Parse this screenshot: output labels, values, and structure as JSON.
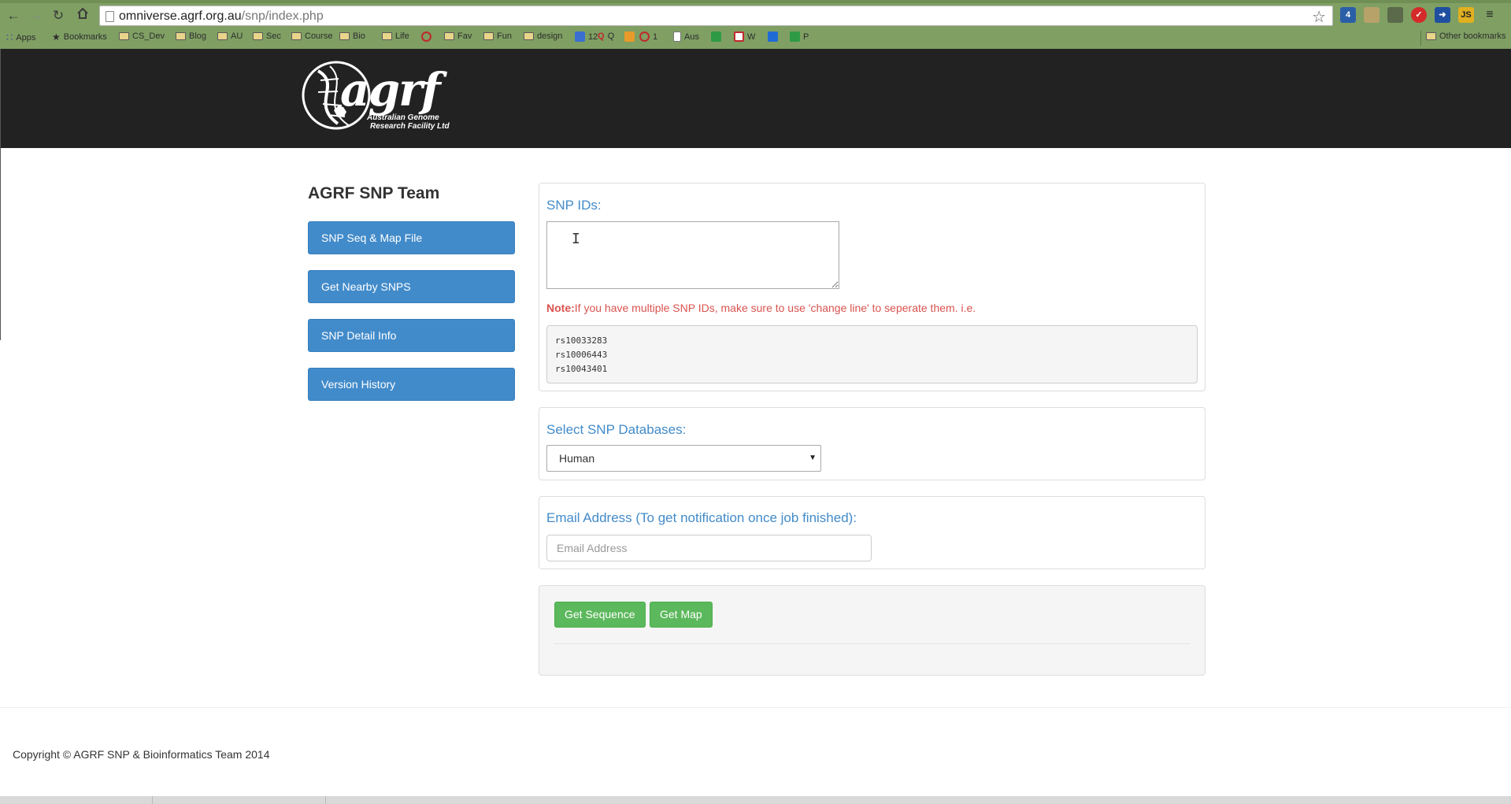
{
  "browser": {
    "url_domain": "omniverse.agrf.org.au",
    "url_path": "/snp/index.php",
    "bookmarks": [
      {
        "label": "Apps",
        "kind": "apps"
      },
      {
        "label": "Bookmarks",
        "kind": "star"
      },
      {
        "label": "CS_Dev",
        "kind": "folder"
      },
      {
        "label": "Blog",
        "kind": "folder"
      },
      {
        "label": "AU",
        "kind": "folder"
      },
      {
        "label": "Sec",
        "kind": "folder"
      },
      {
        "label": "Course",
        "kind": "folder"
      },
      {
        "label": "Bio",
        "kind": "folder"
      },
      {
        "label": "Life",
        "kind": "folder"
      },
      {
        "label": "",
        "kind": "target"
      },
      {
        "label": "Fav",
        "kind": "folder"
      },
      {
        "label": "Fun",
        "kind": "folder"
      },
      {
        "label": "design",
        "kind": "folder"
      },
      {
        "label": "12",
        "kind": "calendar"
      },
      {
        "label": "Q",
        "kind": "q"
      },
      {
        "label": "",
        "kind": "orange"
      },
      {
        "label": "1",
        "kind": "swirl"
      },
      {
        "label": "Aus",
        "kind": "doc"
      },
      {
        "label": "",
        "kind": "sheet"
      },
      {
        "label": "W",
        "kind": "table"
      },
      {
        "label": "",
        "kind": "zhi"
      },
      {
        "label": "P",
        "kind": "sheet"
      }
    ],
    "other_bookmarks": "Other bookmarks"
  },
  "header": {
    "logo_text": "agrf",
    "logo_subtitle_1": "Australian Genome",
    "logo_subtitle_2": "Research Facility Ltd"
  },
  "sidebar": {
    "title": "AGRF SNP Team",
    "items": [
      {
        "label": "SNP Seq & Map File"
      },
      {
        "label": "Get Nearby SNPS"
      },
      {
        "label": "SNP Detail Info"
      },
      {
        "label": "Version History"
      }
    ]
  },
  "snp_ids": {
    "label": "SNP IDs:",
    "value": "",
    "note_prefix": "Note:",
    "note_text": "If you have multiple SNP IDs, make sure to use 'change line' to seperate them. i.e.",
    "examples": [
      "rs10033283",
      "rs10006443",
      "rs10043401"
    ]
  },
  "database": {
    "label": "Select SNP Databases:",
    "selected": "Human"
  },
  "email": {
    "label": "Email Address (To get notification once job finished):",
    "placeholder": "Email Address",
    "value": ""
  },
  "actions": {
    "get_sequence": "Get Sequence",
    "get_map": "Get Map"
  },
  "footer": {
    "copyright": "Copyright © AGRF SNP & Bioinformatics Team 2014"
  },
  "colors": {
    "primary_blue": "#428bca",
    "success_green": "#5cb85c",
    "note_red": "#d9534f",
    "header_dark": "#222222",
    "chrome_green": "#7f9f63"
  }
}
